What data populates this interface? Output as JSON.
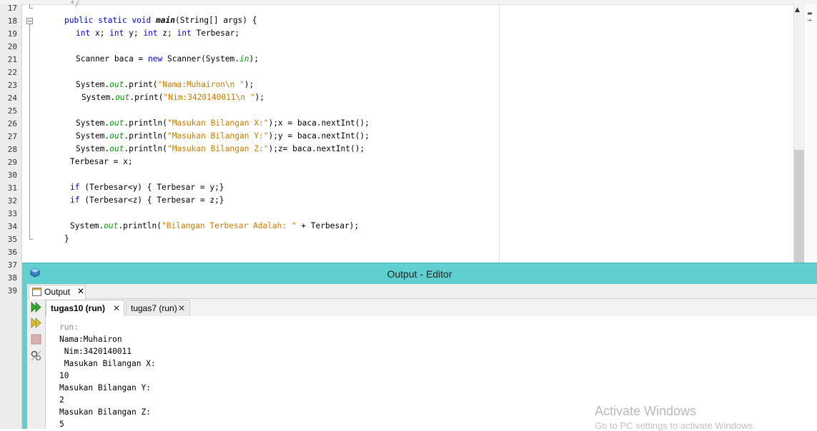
{
  "editor": {
    "line_numbers": [
      "17",
      "18",
      "19",
      "20",
      "21",
      "22",
      "23",
      "24",
      "25",
      "26",
      "27",
      "28",
      "29",
      "30",
      "31",
      "32",
      "33",
      "34",
      "35",
      "36",
      "37",
      "38",
      "39"
    ],
    "lines": {
      "l17": "*/",
      "l18_public": "public",
      "l18_static": "static",
      "l18_void": "void",
      "l18_main": "main",
      "l18_rest": "(String[] args) {",
      "l19_int1": "int",
      "l19_x": " x; ",
      "l19_int2": "int",
      "l19_y": " y; ",
      "l19_int3": "int",
      "l19_z": " z; ",
      "l19_int4": "int",
      "l19_t": " Terbesar;",
      "l21_a": "Scanner baca = ",
      "l21_new": "new",
      "l21_b": " Scanner(System.",
      "l21_in": "in",
      "l21_c": ");",
      "l23_a": "System.",
      "l23_out": "out",
      "l23_b": ".print(",
      "l23_s": "\"Nama:Muhairon\\n \"",
      "l23_c": ");",
      "l24_a": "System.",
      "l24_out": "out",
      "l24_b": ".print(",
      "l24_s": "\"Nim:3420140011\\n \"",
      "l24_c": ");",
      "l26_a": "System.",
      "l26_out": "out",
      "l26_b": ".println(",
      "l26_s": "\"Masukan Bilangan X:\"",
      "l26_c": ");x = baca.nextInt();",
      "l27_a": "System.",
      "l27_out": "out",
      "l27_b": ".println(",
      "l27_s": "\"Masukan Bilangan Y:\"",
      "l27_c": ");y = baca.nextInt();",
      "l28_a": "System.",
      "l28_out": "out",
      "l28_b": ".println(",
      "l28_s": "\"Masukan Bilangan Z:\"",
      "l28_c": ");z= baca.nextInt();",
      "l29": "Terbesar = x;",
      "l31_if": "if",
      "l31_rest": " (Terbesar<y) { Terbesar = y;}",
      "l32_if": "if",
      "l32_rest": " (Terbesar<z) { Terbesar = z;}",
      "l34_a": "System.",
      "l34_out": "out",
      "l34_b": ".println(",
      "l34_s": "\"Bilangan Terbesar Adalah: \"",
      "l34_c": " + Terbesar);",
      "l35": "}"
    }
  },
  "output_window": {
    "title": "Output - Editor",
    "panel_tab": "Output",
    "run_tabs": [
      {
        "label": "tugas10 (run)",
        "active": true
      },
      {
        "label": "tugas7 (run)",
        "active": false
      }
    ],
    "console_lines": [
      "run:",
      "Nama:Muhairon",
      " Nim:3420140011",
      " Masukan Bilangan X:",
      "10",
      "Masukan Bilangan Y:",
      "2",
      "Masukan Bilangan Z:",
      "5"
    ],
    "close_glyph": "✕"
  },
  "watermark": {
    "line1": "Activate Windows",
    "line2": "Go to PC settings to activate Windows."
  },
  "colors": {
    "keyword": "#0000e6",
    "string": "#ce7b00",
    "field": "#009900",
    "titlebar": "#5fcfd0"
  },
  "icons": [
    "fold-toggle-icon",
    "scroll-up-arrow-icon",
    "window-app-icon",
    "output-panel-icon",
    "rerun-icon",
    "rerun-with-options-icon",
    "stop-icon",
    "settings-icon",
    "close-icon"
  ]
}
